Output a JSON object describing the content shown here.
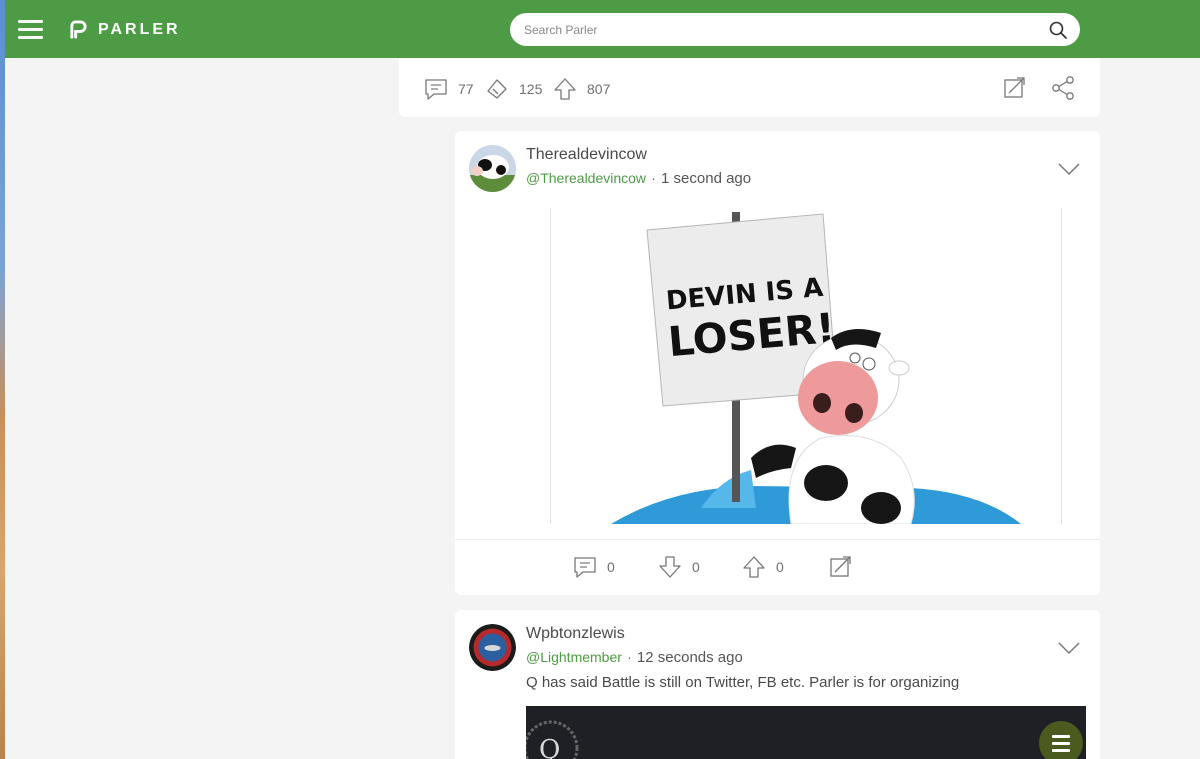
{
  "app": {
    "name": "PARLER",
    "accent": "#4d9c45"
  },
  "search": {
    "placeholder": "Search Parler"
  },
  "previous_post": {
    "comments": "77",
    "echoes": "125",
    "upvotes": "807"
  },
  "posts": [
    {
      "display_name": "Therealdevincow",
      "handle": "@Therealdevincow",
      "time": "1 second ago",
      "image_sign_text": [
        "DEVIN IS A",
        "LOSER!"
      ],
      "comments": "0",
      "downvotes": "0",
      "upvotes": "0"
    },
    {
      "display_name": "Wpbtonzlewis",
      "handle": "@Lightmember",
      "time": "12 seconds ago",
      "text": "Q has said Battle is still on Twitter, FB etc. Parler is for organizing"
    }
  ],
  "icons": [
    "menu-icon",
    "parler-logo-icon",
    "search-icon",
    "comment-icon",
    "echo-icon",
    "upvote-icon",
    "downvote-icon",
    "expand-icon",
    "share-icon",
    "chevron-down-icon"
  ]
}
